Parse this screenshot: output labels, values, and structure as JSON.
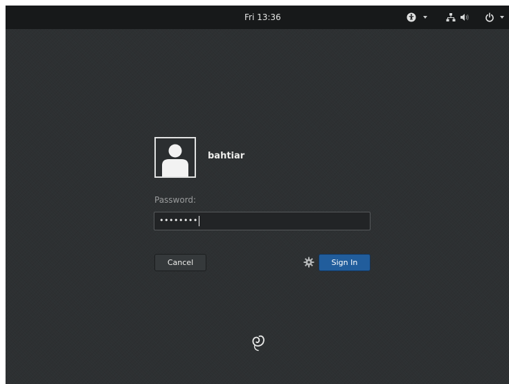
{
  "topbar": {
    "clock": "Fri 13:36",
    "indicators": [
      {
        "icon": "accessibility-icon"
      },
      {
        "icon": "network-icon"
      },
      {
        "icon": "volume-icon"
      },
      {
        "icon": "power-icon"
      }
    ]
  },
  "user": {
    "name": "bahtiar",
    "avatar_icon": "user-avatar-icon"
  },
  "password": {
    "label": "Password:",
    "masked_value": "••••••••"
  },
  "actions": {
    "cancel_label": "Cancel",
    "signin_label": "Sign In",
    "settings_icon": "gear-icon"
  },
  "branding": {
    "logo_icon": "debian-swirl-icon"
  },
  "colors": {
    "background": "#2d3032",
    "topbar": "#17191a",
    "signin_accent": "#215d9c",
    "text": "#eeeeec",
    "muted_text": "#9a9c9d"
  }
}
